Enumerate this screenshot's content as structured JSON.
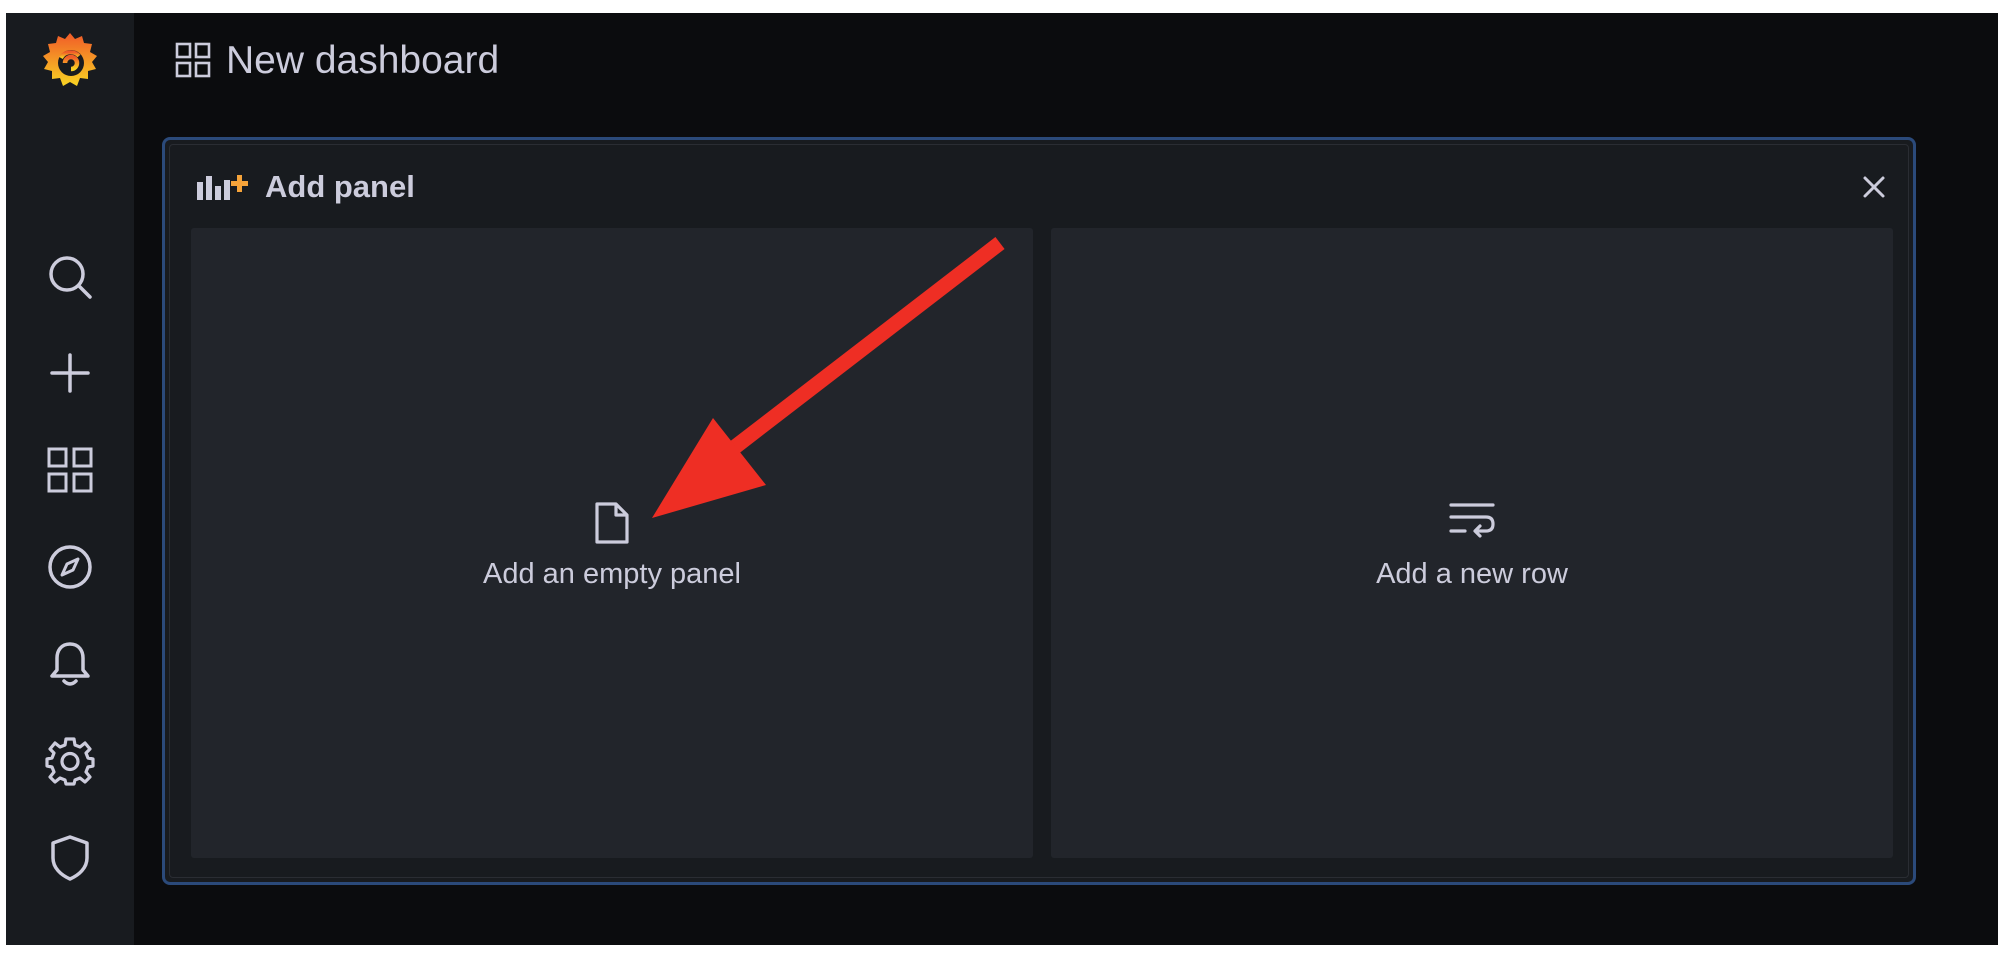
{
  "sidebar": {
    "items": [
      {
        "name": "grafana-logo",
        "icon": "grafana-logo"
      },
      {
        "name": "search",
        "icon": "search-icon"
      },
      {
        "name": "create",
        "icon": "plus-icon"
      },
      {
        "name": "dashboards",
        "icon": "apps-icon"
      },
      {
        "name": "explore",
        "icon": "compass-icon"
      },
      {
        "name": "alerting",
        "icon": "bell-icon"
      },
      {
        "name": "configuration",
        "icon": "gear-icon"
      },
      {
        "name": "server-admin",
        "icon": "shield-icon"
      }
    ]
  },
  "header": {
    "title": "New dashboard",
    "icon": "apps-icon"
  },
  "add_panel": {
    "title": "Add panel",
    "icon": "add-panel-icon",
    "close_icon": "close-icon",
    "options": [
      {
        "label": "Add an empty panel",
        "icon": "file-blank-icon"
      },
      {
        "label": "Add a new row",
        "icon": "wrap-text-icon"
      }
    ]
  },
  "annotation": {
    "arrow_color": "#ee2e24",
    "arrow_target": "add-empty-panel"
  },
  "colors": {
    "background": "#0b0c0e",
    "sidebar": "#181b1f",
    "panel_border": "#2b4a7a",
    "option_bg": "#22252b",
    "text": "#ccccdc",
    "accent_orange": "#f5a33a"
  }
}
